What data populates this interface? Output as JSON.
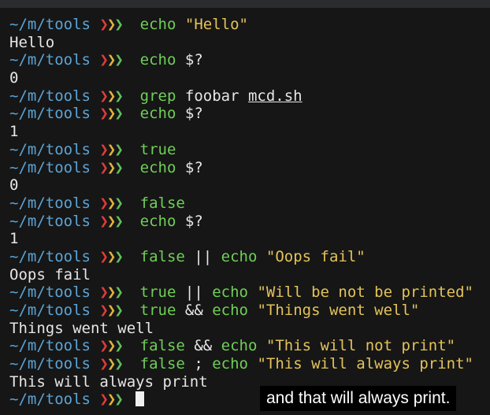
{
  "prompt": {
    "path": "~/m/tools",
    "arrow": "❯"
  },
  "colors": {
    "path": "#5ba4d6",
    "arrow_red": "#e23b3b",
    "arrow_yellow": "#e0b33b",
    "arrow_green": "#5ec15e",
    "command": "#6fcf57",
    "string": "#e4c35a",
    "text": "#e6e6e6",
    "background": "#161616"
  },
  "lines": [
    {
      "type": "cmd",
      "cmd": "echo",
      "rest": [
        {
          "t": "str",
          "v": "\"Hello\""
        }
      ]
    },
    {
      "type": "out",
      "text": "Hello"
    },
    {
      "type": "cmd",
      "cmd": "echo",
      "rest": [
        {
          "t": "arg",
          "v": "$?"
        }
      ]
    },
    {
      "type": "out",
      "text": "0"
    },
    {
      "type": "cmd",
      "cmd": "grep",
      "rest": [
        {
          "t": "arg",
          "v": "foobar"
        },
        {
          "t": "file",
          "v": "mcd.sh"
        }
      ]
    },
    {
      "type": "cmd",
      "cmd": "echo",
      "rest": [
        {
          "t": "arg",
          "v": "$?"
        }
      ]
    },
    {
      "type": "out",
      "text": "1"
    },
    {
      "type": "cmd",
      "cmd": "true",
      "rest": []
    },
    {
      "type": "cmd",
      "cmd": "echo",
      "rest": [
        {
          "t": "arg",
          "v": "$?"
        }
      ]
    },
    {
      "type": "out",
      "text": "0"
    },
    {
      "type": "cmd",
      "cmd": "false",
      "rest": []
    },
    {
      "type": "cmd",
      "cmd": "echo",
      "rest": [
        {
          "t": "arg",
          "v": "$?"
        }
      ]
    },
    {
      "type": "out",
      "text": "1"
    },
    {
      "type": "cmd",
      "cmd": "false",
      "rest": [
        {
          "t": "op",
          "v": "||"
        },
        {
          "t": "cmd",
          "v": "echo"
        },
        {
          "t": "str",
          "v": "\"Oops fail\""
        }
      ]
    },
    {
      "type": "out",
      "text": "Oops fail"
    },
    {
      "type": "cmd",
      "cmd": "true",
      "rest": [
        {
          "t": "op",
          "v": "||"
        },
        {
          "t": "cmd",
          "v": "echo"
        },
        {
          "t": "str",
          "v": "\"Will be not be printed\""
        }
      ]
    },
    {
      "type": "cmd",
      "cmd": "true",
      "rest": [
        {
          "t": "op",
          "v": "&&"
        },
        {
          "t": "cmd",
          "v": "echo"
        },
        {
          "t": "str",
          "v": "\"Things went well\""
        }
      ]
    },
    {
      "type": "out",
      "text": "Things went well"
    },
    {
      "type": "cmd",
      "cmd": "false",
      "rest": [
        {
          "t": "op",
          "v": "&&"
        },
        {
          "t": "cmd",
          "v": "echo"
        },
        {
          "t": "str",
          "v": "\"This will not print\""
        }
      ]
    },
    {
      "type": "cmd",
      "cmd": "false",
      "rest": [
        {
          "t": "op",
          "v": ";"
        },
        {
          "t": "cmd",
          "v": "echo"
        },
        {
          "t": "str",
          "v": "\"This will always print\""
        }
      ]
    },
    {
      "type": "out",
      "text": "This will always print"
    },
    {
      "type": "prompt",
      "cmd": "",
      "rest": []
    }
  ],
  "caption": {
    "text": "and that will always print."
  }
}
